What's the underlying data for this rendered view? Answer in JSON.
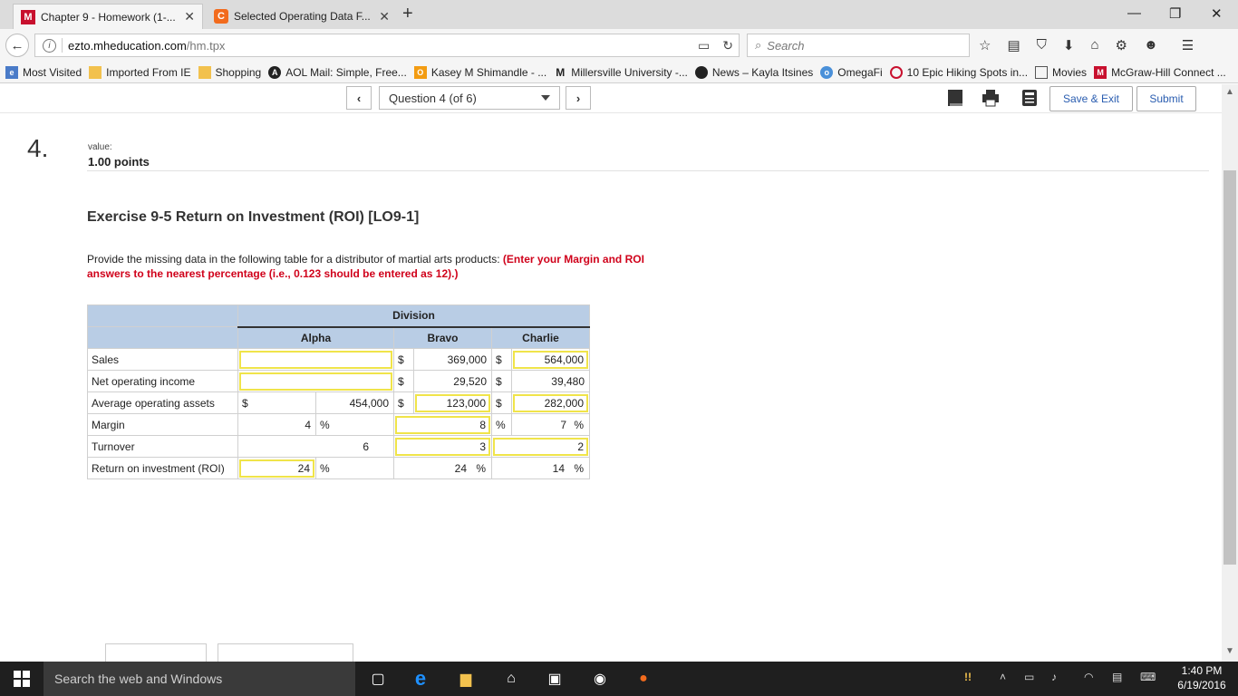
{
  "browser": {
    "tabs": [
      {
        "label": "Chapter 9 - Homework (1-..."
      },
      {
        "label": "Selected Operating Data F..."
      }
    ],
    "url_host": "ezto.mheducation.com",
    "url_path": "/hm.tpx",
    "search_placeholder": "Search",
    "bookmarks": [
      "Most Visited",
      "Imported From IE",
      "Shopping",
      "AOL Mail: Simple, Free...",
      "Kasey M Shimandle - ...",
      "Millersville University -...",
      "News – Kayla Itsines",
      "OmegaFi",
      "10 Epic Hiking Spots in...",
      "Movies",
      "McGraw-Hill Connect ..."
    ]
  },
  "question_nav": {
    "selector_label": "Question 4 (of 6)",
    "save_exit_label": "Save & Exit",
    "submit_label": "Submit"
  },
  "question": {
    "number": "4.",
    "value_label": "value:",
    "points": "1.00 points",
    "title": "Exercise 9-5 Return on Investment (ROI) [LO9-1]",
    "instruction_plain": "Provide the missing data in the following table for a distributor of martial arts products: ",
    "instruction_red": "(Enter your Margin and ROI answers to the nearest percentage (i.e., 0.123 should be entered as 12).)"
  },
  "table": {
    "division_header": "Division",
    "col_alpha": "Alpha",
    "col_bravo": "Bravo",
    "col_charlie": "Charlie",
    "currency": "$",
    "percent": "%",
    "rows": {
      "sales": {
        "label": "Sales",
        "alpha": "",
        "bravo": "369,000",
        "charlie": "564,000"
      },
      "noi": {
        "label": "Net operating income",
        "alpha": "",
        "bravo": "29,520",
        "charlie": "39,480"
      },
      "assets": {
        "label": "Average operating assets",
        "alpha": "454,000",
        "bravo": "123,000",
        "charlie": "282,000"
      },
      "margin": {
        "label": "Margin",
        "alpha": "4",
        "bravo": "8",
        "charlie": "7"
      },
      "turnover": {
        "label": "Turnover",
        "alpha": "6",
        "bravo": "3",
        "charlie": "2"
      },
      "roi": {
        "label": "Return on investment (ROI)",
        "alpha": "24",
        "bravo": "24",
        "charlie": "14"
      }
    }
  },
  "taskbar": {
    "search_placeholder": "Search the web and Windows",
    "time": "1:40 PM",
    "date": "6/19/2016"
  },
  "colors": {
    "table_header": "#b9cde5",
    "input_border": "#f0e44a",
    "instruction_red": "#d0021b",
    "link_blue": "#2a5db0"
  }
}
